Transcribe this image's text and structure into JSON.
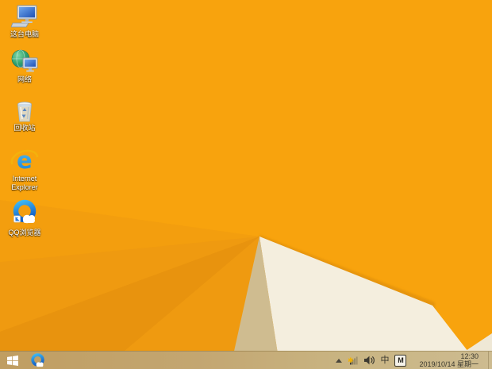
{
  "wallpaper": {
    "colors": {
      "base": "#F8A30D",
      "subtle_facet": "#F39E0E",
      "left_facet": "#EF9A10",
      "left_dark_facet": "#E8930E",
      "edge_shadow": "#D8890A",
      "cream_facet": "#F4EEDE",
      "khaki_facet": "#CFBC90",
      "corner_facet": "#EFE8D6"
    }
  },
  "desktop": {
    "icons": [
      {
        "icon": "this-pc",
        "label": "这台电脑"
      },
      {
        "icon": "network",
        "label": "网络"
      },
      {
        "icon": "recycle-bin",
        "label": "回收站"
      },
      {
        "icon": "internet-explorer",
        "label": "Internet Explorer"
      },
      {
        "icon": "qq-browser",
        "label": "QQ浏览器"
      }
    ]
  },
  "taskbar": {
    "start": {
      "icon": "windows-logo"
    },
    "pinned": [
      {
        "icon": "qq-browser"
      }
    ],
    "tray": {
      "icons": [
        "chevron-up",
        "network-warning",
        "volume",
        "ime-indicator",
        "ime-badge"
      ],
      "ime_mode": "中",
      "ime_badge": "M",
      "clock_time": "12:30",
      "clock_date": "2019/10/14 星期一"
    }
  }
}
